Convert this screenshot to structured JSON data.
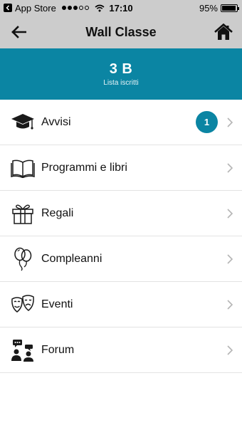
{
  "status_bar": {
    "back_app": "App Store",
    "time": "17:10",
    "battery": "95%",
    "battery_level": 0.95,
    "signal_bars_on": 3,
    "signal_bars_total": 5
  },
  "nav": {
    "title": "Wall Classe",
    "back_icon": "arrow-left-icon",
    "home_icon": "home-icon"
  },
  "class_header": {
    "name": "3 B",
    "subtitle": "Lista iscritti",
    "background": "#0b85a3"
  },
  "menu": {
    "items": [
      {
        "label": "Avvisi",
        "icon": "graduation-cap-icon",
        "badge": "1"
      },
      {
        "label": "Programmi e libri",
        "icon": "open-book-icon"
      },
      {
        "label": "Regali",
        "icon": "gift-icon"
      },
      {
        "label": "Compleanni",
        "icon": "balloons-icon"
      },
      {
        "label": "Eventi",
        "icon": "theater-masks-icon"
      },
      {
        "label": "Forum",
        "icon": "forum-people-icon"
      }
    ]
  },
  "colors": {
    "accent": "#0b85a3",
    "bar_gray": "#cccccc"
  }
}
